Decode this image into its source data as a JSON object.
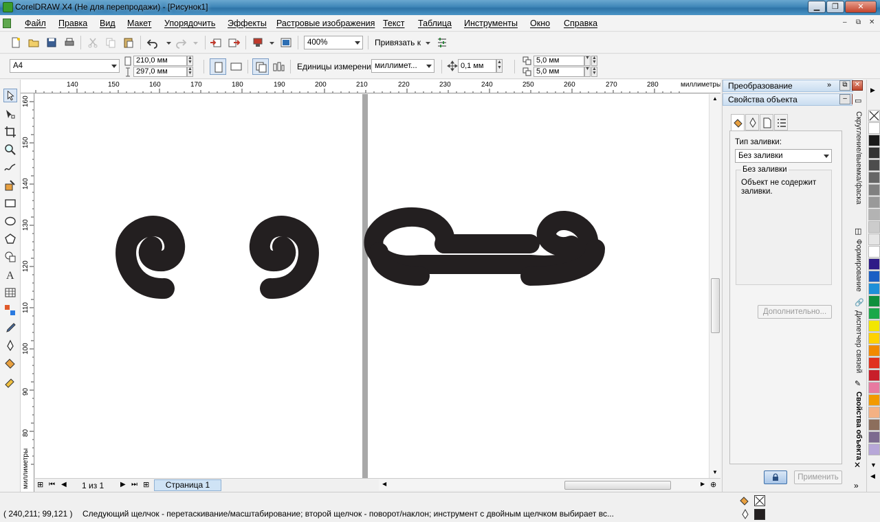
{
  "window": {
    "title": "CorelDRAW X4 (Не для перепродажи) - [Рисунок1]",
    "minimize": "▁",
    "maximize": "❐",
    "close": "✕"
  },
  "menu": [
    "Файл",
    "Правка",
    "Вид",
    "Макет",
    "Упорядочить",
    "Эффекты",
    "Растровые изображения",
    "Текст",
    "Таблица",
    "Инструменты",
    "Окно",
    "Справка"
  ],
  "mdi_controls": [
    "–",
    "⧉",
    "✕"
  ],
  "toolbar": {
    "zoom": "400%",
    "snap": "Привязать к"
  },
  "property_bar": {
    "page_size": "A4",
    "width": "210,0 мм",
    "height": "297,0 мм",
    "units_label": "Единицы измерения:",
    "units_value": "миллимет...",
    "nudge": "0,1 мм",
    "dup_x": "5,0 мм",
    "dup_y": "5,0 мм"
  },
  "ruler_top": {
    "labels": [
      "140",
      "150",
      "160",
      "170",
      "180",
      "190",
      "200",
      "210",
      "220",
      "230",
      "240",
      "250",
      "260",
      "270",
      "280"
    ],
    "unit": "миллиметры"
  },
  "ruler_left": {
    "labels": [
      "160",
      "150",
      "140",
      "130",
      "120",
      "110",
      "100",
      "90",
      "80"
    ],
    "unit": "миллиметры"
  },
  "page_nav": {
    "page_count": "1 из 1",
    "page_tab": "Страница 1"
  },
  "docker": {
    "transform_title": "Преобразование",
    "props_title": "Свойства объекта",
    "fill_type_label": "Тип заливки:",
    "fill_type_value": "Без заливки",
    "group_title": "Без заливки",
    "group_text": "Объект не содержит заливки.",
    "more_button": "Дополнительно...",
    "apply_button": "Применить"
  },
  "vertical_tabs": [
    "Скругление/выемка/фаска",
    "Формирование",
    "Диспетчер связей",
    "Свойства объекта"
  ],
  "palette": [
    "#ffffff",
    "#1a1a1a",
    "#333333",
    "#4d4d4d",
    "#666666",
    "#808080",
    "#999999",
    "#b3b3b3",
    "#cccccc",
    "#e6e6e6",
    "#ffffff",
    "#2e1b87",
    "#1b5fc4",
    "#1e8fd8",
    "#0f8f3c",
    "#1aa84a",
    "#f2e600",
    "#ffd200",
    "#f28a00",
    "#e0301e",
    "#c81e2a",
    "#e87aa0",
    "#f29a00",
    "#f4b183",
    "#8c6e5c",
    "#7c6b8f",
    "#b7a7d8",
    "#9b8bc6",
    "#6e5ea8",
    "#a99cc9",
    "#c7c2e0",
    "#7d7494",
    "#bcb7cf",
    "#57536b",
    "#7a7587",
    "#9e9aab"
  ],
  "status": {
    "coords": "( 240,211; 99,121 )",
    "hint": "Следующий щелчок - перетаскивание/масштабирование; второй щелчок - поворот/наклон; инструмент с двойным щелчком выбирает вс..."
  }
}
